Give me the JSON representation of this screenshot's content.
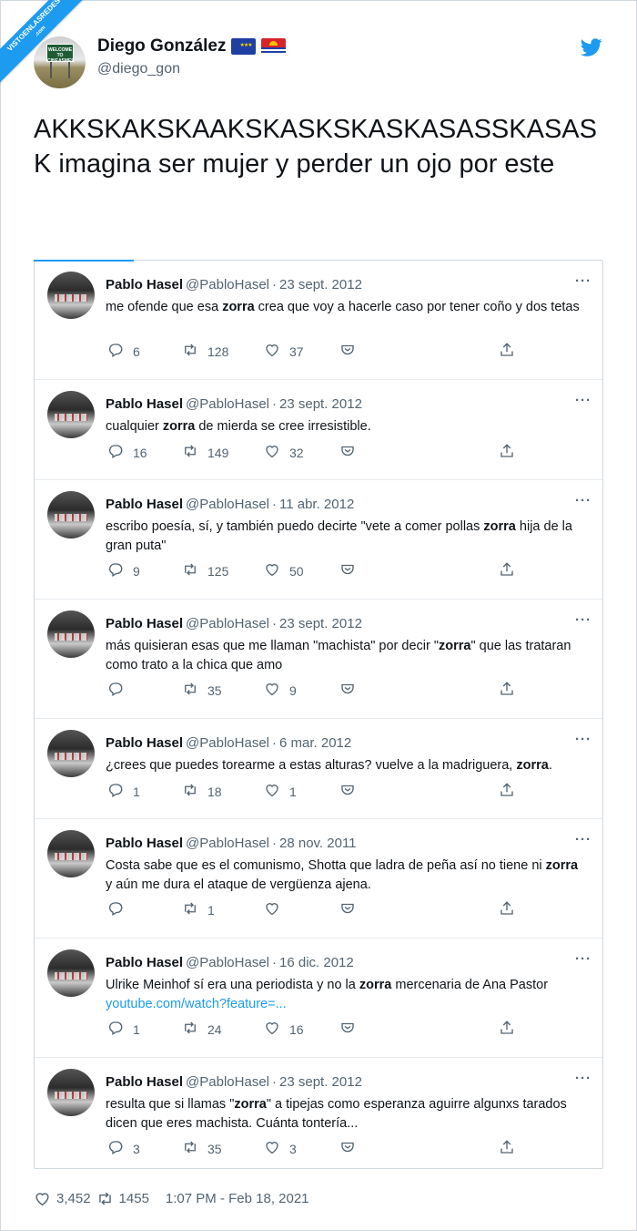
{
  "watermark": {
    "line1": "VISTOENLASREDES",
    "line2": ".com"
  },
  "author": {
    "name": "Diego González",
    "handle": "@diego_gon",
    "avatar_sign": "WELCOME TO CINEASMER",
    "flags": [
      "eu-flag",
      "kiribati-flag"
    ]
  },
  "tweet": {
    "text": "AKKSKAKSKAAKSKASKSKASKASASSKASASK imagina ser mujer y perder un ojo por este"
  },
  "quoted": [
    {
      "name": "Pablo Hasel",
      "handle": "@PabloHasel",
      "date": "23 sept. 2012",
      "before": "me ofende que esa ",
      "bold": "zorra",
      "after": " crea que voy a hacerle caso por tener coño y dos tetas",
      "link": "",
      "replies": "6",
      "retweets": "128",
      "likes": "37"
    },
    {
      "name": "Pablo Hasel",
      "handle": "@PabloHasel",
      "date": "23 sept. 2012",
      "before": "cualquier ",
      "bold": "zorra",
      "after": " de mierda se cree irresistible.",
      "link": "",
      "replies": "16",
      "retweets": "149",
      "likes": "32"
    },
    {
      "name": "Pablo Hasel",
      "handle": "@PabloHasel",
      "date": "11 abr. 2012",
      "before": "escribo poesía, sí, y también puedo decirte \"vete a comer pollas ",
      "bold": "zorra",
      "after": " hija de la gran puta\"",
      "link": "",
      "replies": "9",
      "retweets": "125",
      "likes": "50"
    },
    {
      "name": "Pablo Hasel",
      "handle": "@PabloHasel",
      "date": "23 sept. 2012",
      "before": "más quisieran esas que me llaman \"machista\" por decir \"",
      "bold": "zorra",
      "after": "\" que las trataran como trato a la chica que amo",
      "link": "",
      "replies": "",
      "retweets": "35",
      "likes": "9"
    },
    {
      "name": "Pablo Hasel",
      "handle": "@PabloHasel",
      "date": "6 mar. 2012",
      "before": "¿crees que puedes torearme a estas alturas? vuelve a la madriguera, ",
      "bold": "zorra",
      "after": ".",
      "link": "",
      "replies": "1",
      "retweets": "18",
      "likes": "1"
    },
    {
      "name": "Pablo Hasel",
      "handle": "@PabloHasel",
      "date": "28 nov. 2011",
      "before": "Costa sabe que es el comunismo, Shotta que ladra de peña así no tiene ni ",
      "bold": "zorra",
      "after": " y aún me dura el ataque de vergüenza ajena.",
      "link": "",
      "replies": "",
      "retweets": "1",
      "likes": ""
    },
    {
      "name": "Pablo Hasel",
      "handle": "@PabloHasel",
      "date": "16 dic. 2012",
      "before": "Ulrike Meinhof sí era una periodista y no la ",
      "bold": "zorra",
      "after": " mercenaria de Ana Pastor",
      "link": "youtube.com/watch?feature=...",
      "replies": "1",
      "retweets": "24",
      "likes": "16"
    },
    {
      "name": "Pablo Hasel",
      "handle": "@PabloHasel",
      "date": "23 sept. 2012",
      "before": "resulta que si llamas \"",
      "bold": "zorra",
      "after": "\" a tipejas como esperanza aguirre algunxs tarados dicen que eres machista. Cuánta tontería...",
      "link": "",
      "replies": "3",
      "retweets": "35",
      "likes": "3"
    }
  ],
  "footer": {
    "likes": "3,452",
    "retweets": "1455",
    "timestamp": "1:07 PM - Feb 18, 2021"
  },
  "colors": {
    "accent": "#1d9bf0",
    "muted": "#536471",
    "text": "#0f1419",
    "border": "#cfd9de"
  }
}
